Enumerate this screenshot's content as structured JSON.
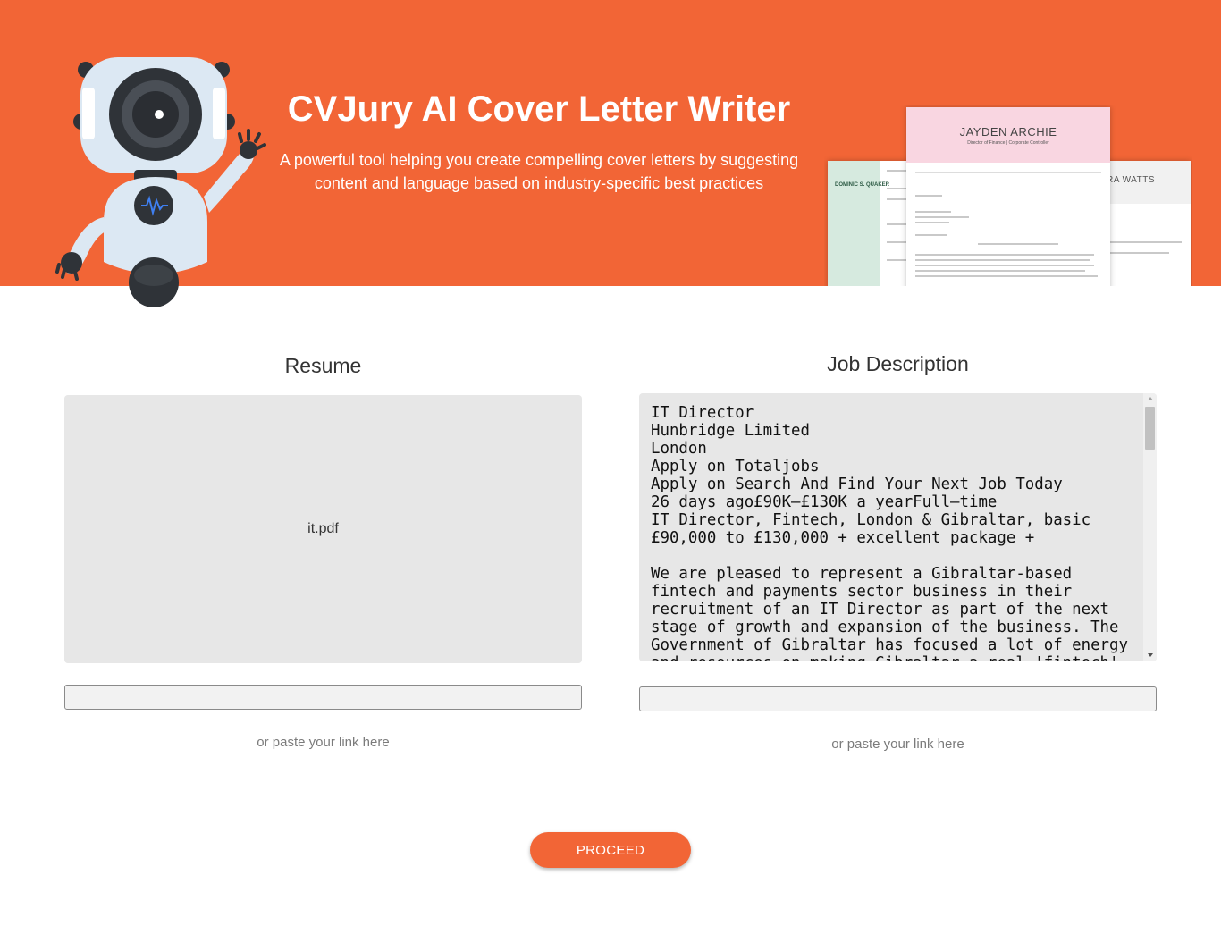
{
  "colors": {
    "brand": "#f26536",
    "white": "#ffffff",
    "panel": "#e7e7e7"
  },
  "hero": {
    "title": "CVJury AI Cover Letter Writer",
    "subtitle": "A powerful tool helping you create compelling cover letters by suggesting content and language based on industry-specific best practices",
    "mascot_icon": "robot-mascot",
    "sample_docs": {
      "main_name": "JAYDEN ARCHIE",
      "main_role": "Director of Finance | Corporate Controller",
      "left_name": "DOMINIC S. QUAKER",
      "right_name": "RA WATTS"
    }
  },
  "resume": {
    "heading": "Resume",
    "file_name": "it.pdf",
    "link_value": "",
    "hint": "or paste your link here"
  },
  "job": {
    "heading": "Job Description",
    "text": "IT Director\nHunbridge Limited\nLondon\nApply on Totaljobs\nApply on Search And Find Your Next Job Today\n26 days ago£90K–£130K a yearFull–time\nIT Director, Fintech, London & Gibraltar, basic £90,000 to £130,000 + excellent package +\n\nWe are pleased to represent a Gibraltar-based fintech and payments sector business in their recruitment of an IT Director as part of the next stage of growth and expansion of the business. The Government of Gibraltar has focused a lot of energy and resources on making Gibraltar a real 'fintech'",
    "link_value": "",
    "hint": "or paste your link here"
  },
  "proceed_label": "PROCEED"
}
